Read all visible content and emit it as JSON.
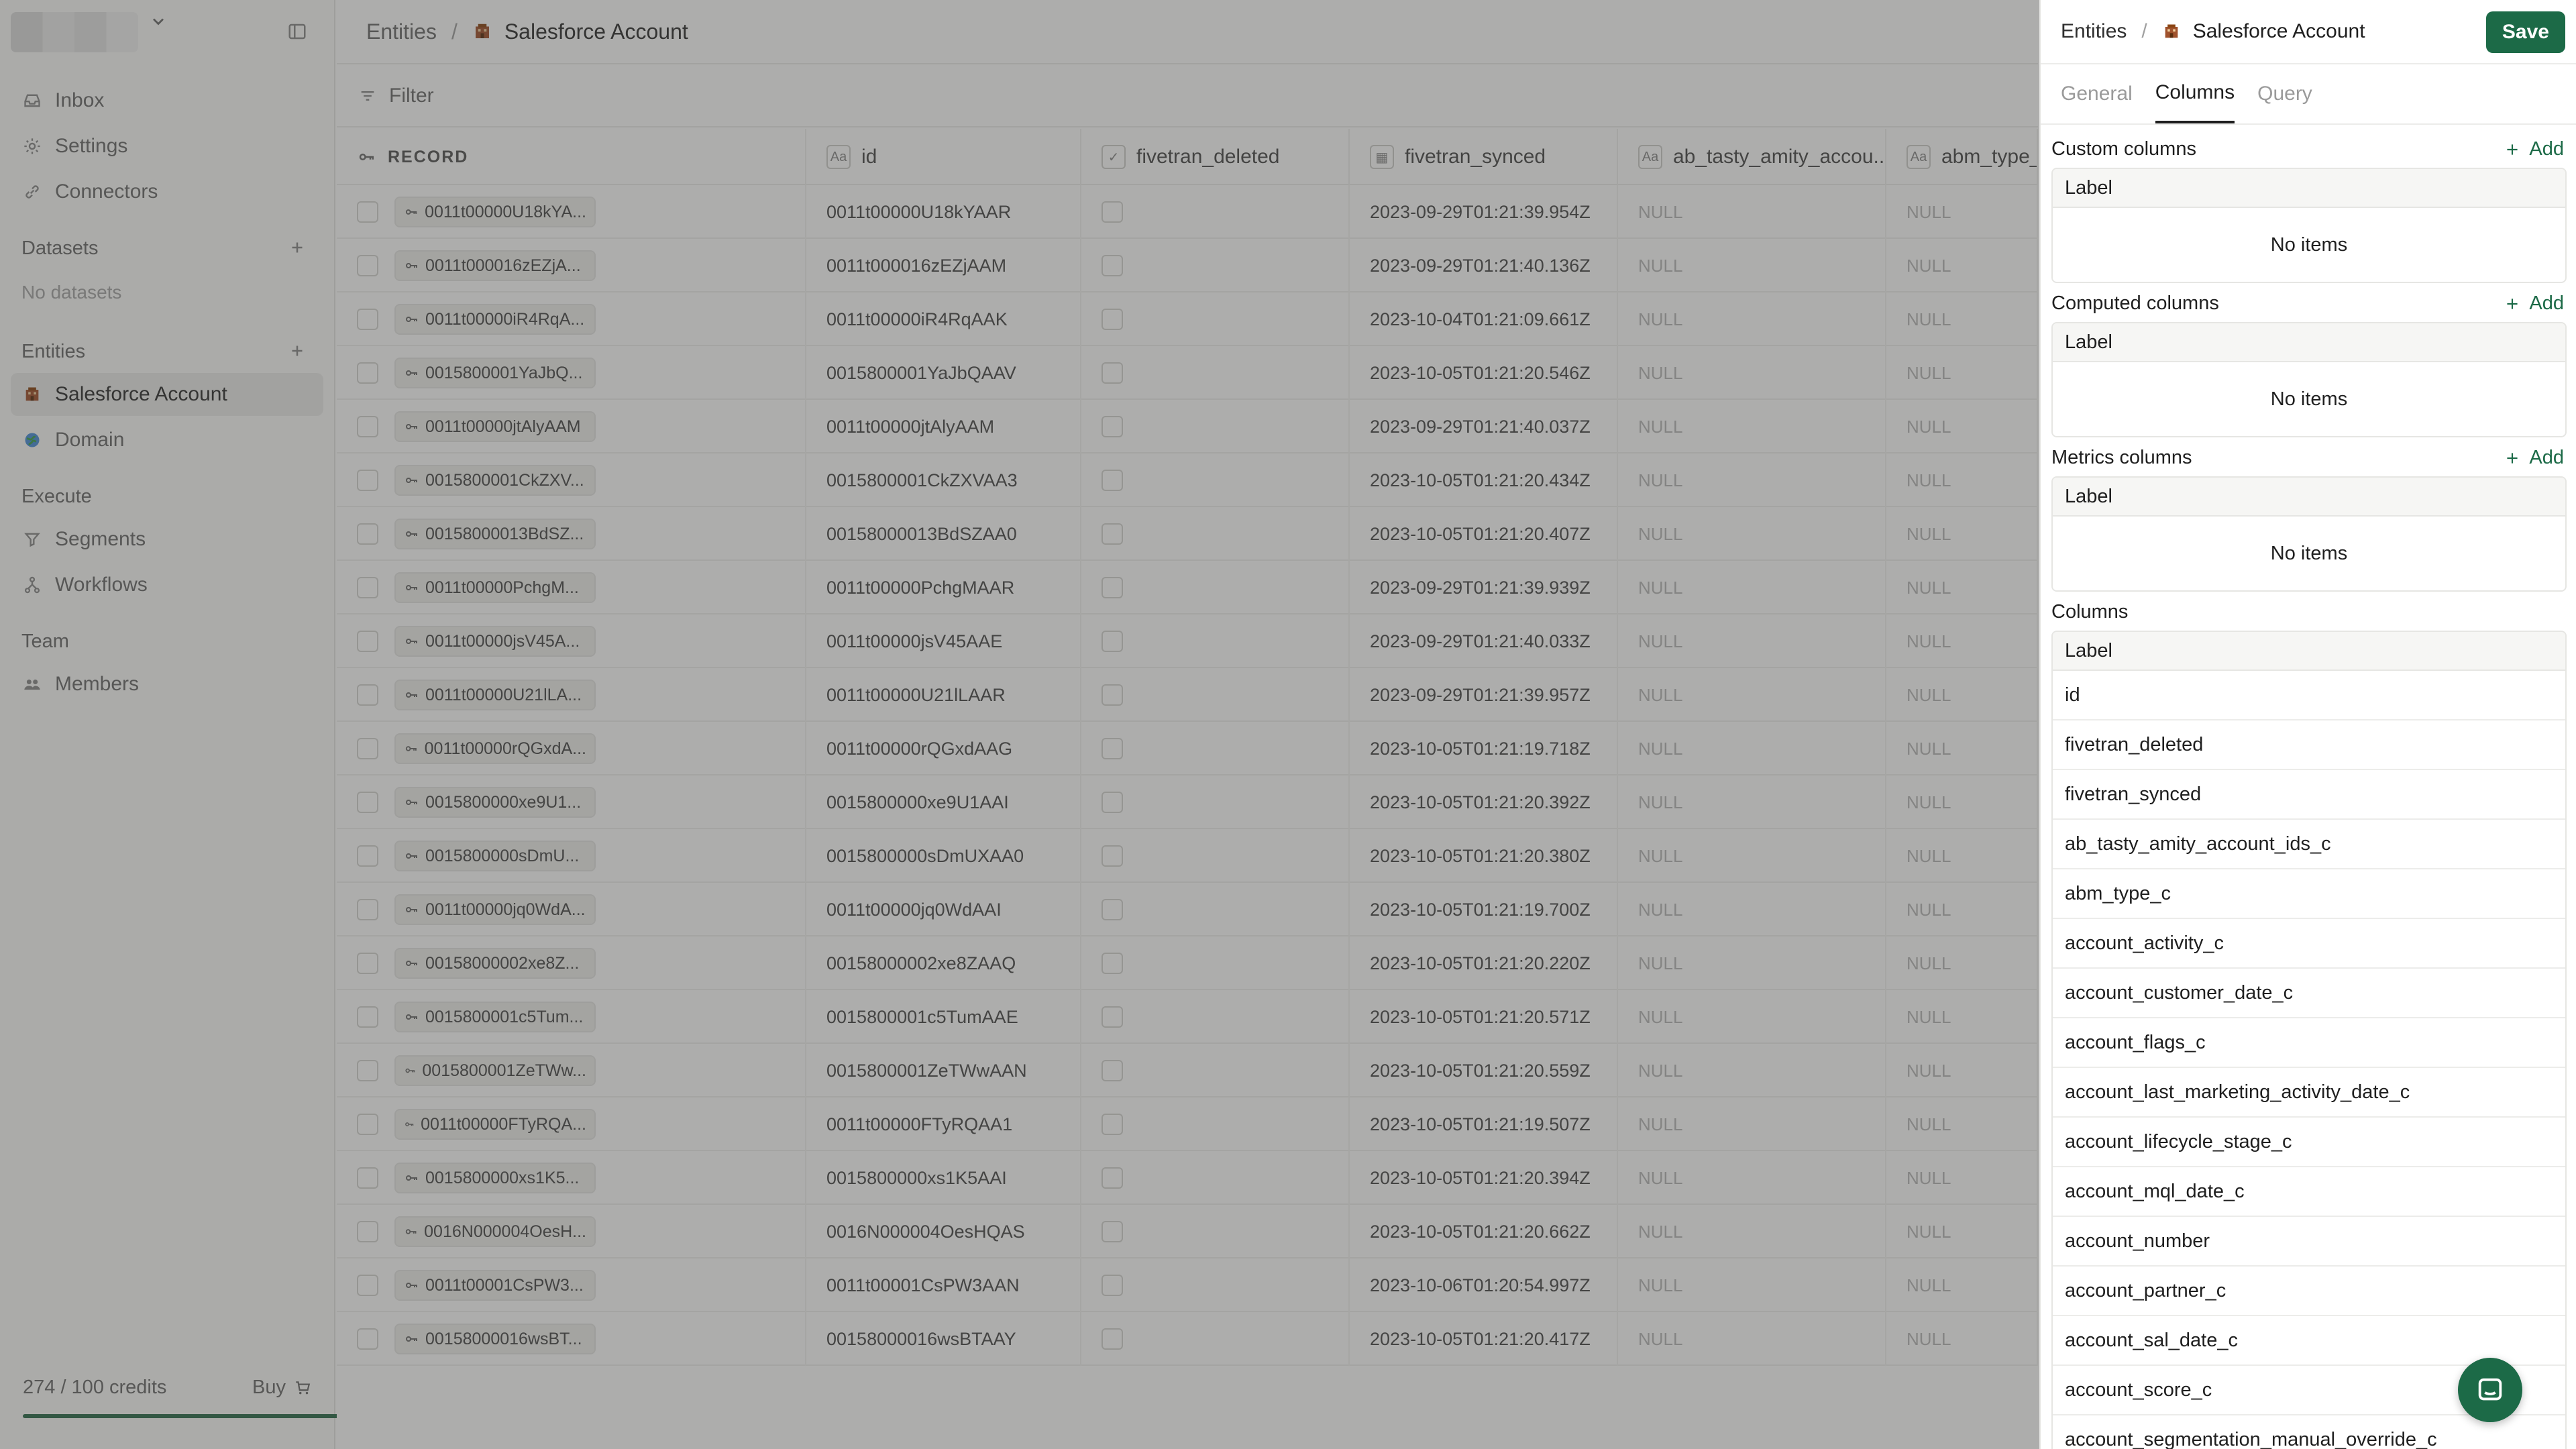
{
  "sidebar": {
    "nav_top": [
      {
        "label": "Inbox",
        "icon": "inbox-icon"
      },
      {
        "label": "Settings",
        "icon": "gear-icon"
      },
      {
        "label": "Connectors",
        "icon": "link-icon"
      }
    ],
    "datasets_title": "Datasets",
    "datasets_empty": "No datasets",
    "entities_title": "Entities",
    "entities": [
      {
        "label": "Salesforce Account",
        "icon": "building-icon",
        "active": true
      },
      {
        "label": "Domain",
        "icon": "globe-icon",
        "active": false
      }
    ],
    "execute_title": "Execute",
    "execute": [
      {
        "label": "Segments",
        "icon": "filter-icon"
      },
      {
        "label": "Workflows",
        "icon": "workflow-icon"
      }
    ],
    "team_title": "Team",
    "team": [
      {
        "label": "Members",
        "icon": "members-icon"
      }
    ],
    "credits": "274 / 100 credits",
    "credits_fraction": 1.0,
    "buy_label": "Buy"
  },
  "main": {
    "breadcrumb_root": "Entities",
    "breadcrumb_sep": "/",
    "breadcrumb_current": "Salesforce Account",
    "filter_label": "Filter",
    "columns": [
      {
        "label": "RECORD",
        "type": "record"
      },
      {
        "label": "id",
        "type": "Aa"
      },
      {
        "label": "fivetran_deleted",
        "type": "bool"
      },
      {
        "label": "fivetran_synced",
        "type": "date"
      },
      {
        "label": "ab_tasty_amity_accou...",
        "type": "Aa"
      },
      {
        "label": "abm_type_c",
        "type": "Aa"
      }
    ],
    "null_text": "NULL",
    "rows": [
      {
        "rec": "0011t00000U18kYA...",
        "id": "0011t00000U18kYAAR",
        "synced": "2023-09-29T01:21:39.954Z"
      },
      {
        "rec": "0011t000016zEZjA...",
        "id": "0011t000016zEZjAAM",
        "synced": "2023-09-29T01:21:40.136Z"
      },
      {
        "rec": "0011t00000iR4RqA...",
        "id": "0011t00000iR4RqAAK",
        "synced": "2023-10-04T01:21:09.661Z"
      },
      {
        "rec": "0015800001YaJbQ...",
        "id": "0015800001YaJbQAAV",
        "synced": "2023-10-05T01:21:20.546Z"
      },
      {
        "rec": "0011t00000jtAlyAAM",
        "id": "0011t00000jtAlyAAM",
        "synced": "2023-09-29T01:21:40.037Z"
      },
      {
        "rec": "0015800001CkZXV...",
        "id": "0015800001CkZXVAA3",
        "synced": "2023-10-05T01:21:20.434Z"
      },
      {
        "rec": "00158000013BdSZ...",
        "id": "00158000013BdSZAA0",
        "synced": "2023-10-05T01:21:20.407Z"
      },
      {
        "rec": "0011t00000PchgM...",
        "id": "0011t00000PchgMAAR",
        "synced": "2023-09-29T01:21:39.939Z"
      },
      {
        "rec": "0011t00000jsV45A...",
        "id": "0011t00000jsV45AAE",
        "synced": "2023-09-29T01:21:40.033Z"
      },
      {
        "rec": "0011t00000U21lLA...",
        "id": "0011t00000U21lLAAR",
        "synced": "2023-09-29T01:21:39.957Z"
      },
      {
        "rec": "0011t00000rQGxdA...",
        "id": "0011t00000rQGxdAAG",
        "synced": "2023-10-05T01:21:19.718Z"
      },
      {
        "rec": "0015800000xe9U1...",
        "id": "0015800000xe9U1AAI",
        "synced": "2023-10-05T01:21:20.392Z"
      },
      {
        "rec": "0015800000sDmU...",
        "id": "0015800000sDmUXAA0",
        "synced": "2023-10-05T01:21:20.380Z"
      },
      {
        "rec": "0011t00000jq0WdA...",
        "id": "0011t00000jq0WdAAI",
        "synced": "2023-10-05T01:21:19.700Z"
      },
      {
        "rec": "00158000002xe8Z...",
        "id": "00158000002xe8ZAAQ",
        "synced": "2023-10-05T01:21:20.220Z"
      },
      {
        "rec": "0015800001c5Tum...",
        "id": "0015800001c5TumAAE",
        "synced": "2023-10-05T01:21:20.571Z"
      },
      {
        "rec": "0015800001ZeTWw...",
        "id": "0015800001ZeTWwAAN",
        "synced": "2023-10-05T01:21:20.559Z"
      },
      {
        "rec": "0011t00000FTyRQA...",
        "id": "0011t00000FTyRQAA1",
        "synced": "2023-10-05T01:21:19.507Z"
      },
      {
        "rec": "0015800000xs1K5...",
        "id": "0015800000xs1K5AAI",
        "synced": "2023-10-05T01:21:20.394Z"
      },
      {
        "rec": "0016N000004OesH...",
        "id": "0016N000004OesHQAS",
        "synced": "2023-10-05T01:21:20.662Z"
      },
      {
        "rec": "0011t00001CsPW3...",
        "id": "0011t00001CsPW3AAN",
        "synced": "2023-10-06T01:20:54.997Z"
      },
      {
        "rec": "00158000016wsBT...",
        "id": "00158000016wsBTAAY",
        "synced": "2023-10-05T01:21:20.417Z"
      }
    ]
  },
  "panel": {
    "breadcrumb_root": "Entities",
    "breadcrumb_sep": "/",
    "breadcrumb_current": "Salesforce Account",
    "save_label": "Save",
    "tabs": [
      {
        "label": "General",
        "active": false
      },
      {
        "label": "Columns",
        "active": true
      },
      {
        "label": "Query",
        "active": false
      }
    ],
    "add_label": "Add",
    "label_header": "Label",
    "no_items": "No items",
    "custom_title": "Custom columns",
    "computed_title": "Computed columns",
    "metrics_title": "Metrics columns",
    "columns_title": "Columns",
    "columns": [
      "id",
      "fivetran_deleted",
      "fivetran_synced",
      "ab_tasty_amity_account_ids_c",
      "abm_type_c",
      "account_activity_c",
      "account_customer_date_c",
      "account_flags_c",
      "account_last_marketing_activity_date_c",
      "account_lifecycle_stage_c",
      "account_mql_date_c",
      "account_number",
      "account_partner_c",
      "account_sal_date_c",
      "account_score_c",
      "account_segmentation_manual_override_c"
    ]
  },
  "colors": {
    "accent": "#1c6a47",
    "overlay": "rgba(60,60,58,0.42)"
  }
}
